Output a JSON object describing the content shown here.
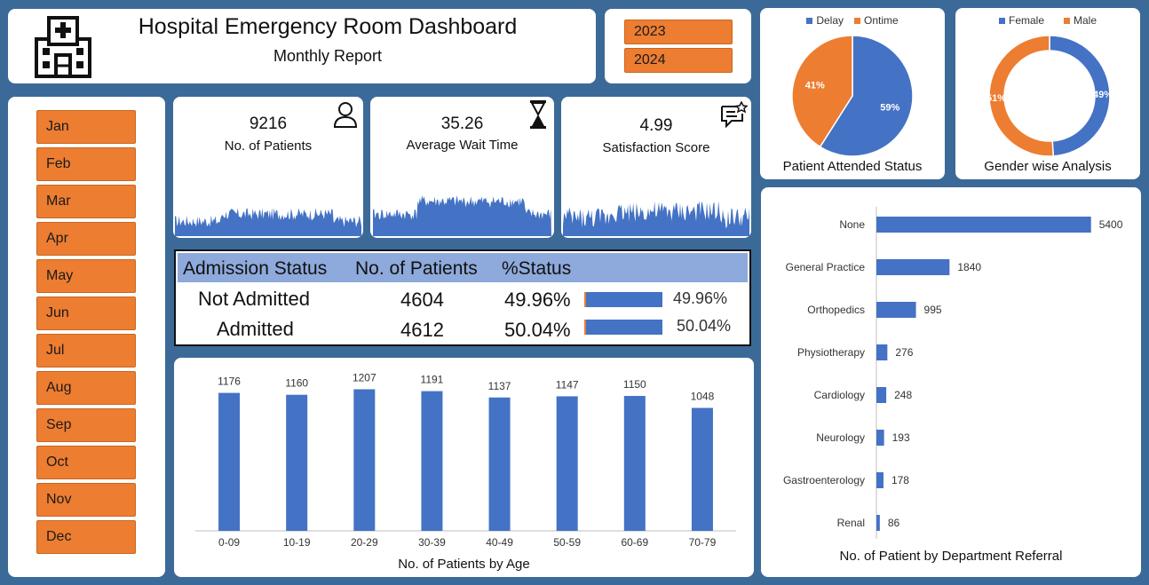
{
  "header": {
    "title": "Hospital Emergency Room Dashboard",
    "subtitle": "Monthly Report",
    "icon": "hospital-building-icon"
  },
  "years": [
    "2023",
    "2024"
  ],
  "months": [
    "Jan",
    "Feb",
    "Mar",
    "Apr",
    "May",
    "Jun",
    "Jul",
    "Aug",
    "Sep",
    "Oct",
    "Nov",
    "Dec"
  ],
  "kpis": [
    {
      "value": "9216",
      "label": "No. of Patients",
      "icon": "person-icon"
    },
    {
      "value": "35.26",
      "label": "Average Wait Time",
      "icon": "hourglass-icon"
    },
    {
      "value": "4.99",
      "label": "Satisfaction Score",
      "icon": "chat-star-icon"
    }
  ],
  "admission": {
    "headers": [
      "Admission Status",
      "No. of Patients",
      "%Status"
    ],
    "rows": [
      {
        "status": "Not Admitted",
        "count": "4604",
        "pct": "49.96%",
        "bar_label": "49.96%",
        "fraction": 0.4996
      },
      {
        "status": "Admitted",
        "count": "4612",
        "pct": "50.04%",
        "bar_label": "50.04%",
        "fraction": 0.5004
      }
    ]
  },
  "colors": {
    "blue": "#4472c4",
    "orange": "#ed7d31",
    "navy": "#3b6a98",
    "header_fill": "#8ea9db"
  },
  "chart_data": [
    {
      "id": "attended",
      "type": "pie",
      "title": "Patient Attended Status",
      "legend": [
        "Delay",
        "Ontime"
      ],
      "slices": [
        {
          "name": "Delay",
          "value": 59,
          "label": "59%",
          "color": "#4472c4"
        },
        {
          "name": "Ontime",
          "value": 41,
          "label": "41%",
          "color": "#ed7d31"
        }
      ],
      "legend_position": "top"
    },
    {
      "id": "gender",
      "type": "pie",
      "title": "Gender wise Analysis",
      "legend": [
        "Female",
        "Male"
      ],
      "slices": [
        {
          "name": "Female",
          "value": 49,
          "label": "49%",
          "color": "#4472c4"
        },
        {
          "name": "Male",
          "value": 51,
          "label": "51%",
          "color": "#ed7d31"
        }
      ],
      "legend_position": "top"
    },
    {
      "id": "age",
      "type": "bar",
      "title": "No. of Patients by Age",
      "categories": [
        "0-09",
        "10-19",
        "20-29",
        "30-39",
        "40-49",
        "50-59",
        "60-69",
        "70-79"
      ],
      "values": [
        1176,
        1160,
        1207,
        1191,
        1137,
        1147,
        1150,
        1048
      ],
      "ylim": [
        0,
        1400
      ],
      "grid": false
    },
    {
      "id": "department",
      "type": "bar",
      "orientation": "horizontal",
      "title": "No. of Patient by Department Referral",
      "categories": [
        "None",
        "General Practice",
        "Orthopedics",
        "Physiotherapy",
        "Cardiology",
        "Neurology",
        "Gastroenterology",
        "Renal"
      ],
      "values": [
        5400,
        1840,
        995,
        276,
        248,
        193,
        178,
        86
      ],
      "xlim": [
        0,
        6300
      ],
      "grid": false
    }
  ]
}
